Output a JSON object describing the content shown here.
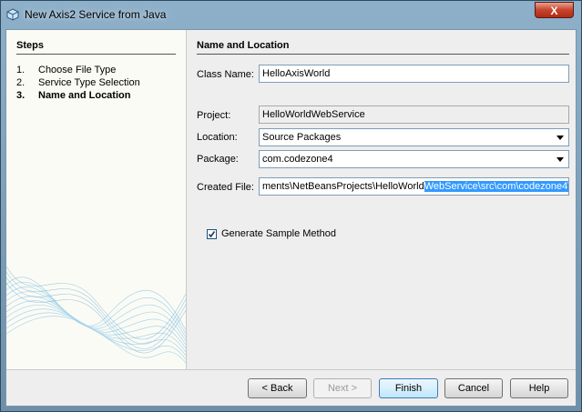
{
  "window": {
    "title": "New Axis2 Service from Java",
    "close_label": "X"
  },
  "steps": {
    "title": "Steps",
    "items": [
      {
        "num": "1.",
        "label": "Choose File Type"
      },
      {
        "num": "2.",
        "label": "Service Type Selection"
      },
      {
        "num": "3.",
        "label": "Name and Location"
      }
    ]
  },
  "panel": {
    "title": "Name and Location",
    "class_name": {
      "label": "Class Name:",
      "value": "HelloAxisWorld"
    },
    "project": {
      "label": "Project:",
      "value": "HelloWorldWebService"
    },
    "location": {
      "label": "Location:",
      "value": "Source Packages"
    },
    "package": {
      "label": "Package:",
      "value": "com.codezone4"
    },
    "created_file": {
      "label": "Created File:",
      "value_plain": "ments\\NetBeansProjects\\HelloWorld",
      "value_selected": "WebService\\src\\com\\codezone4\\H"
    },
    "generate_sample": {
      "label": "Generate Sample Method",
      "checked": true
    }
  },
  "buttons": {
    "back": "< Back",
    "next": "Next >",
    "finish": "Finish",
    "cancel": "Cancel",
    "help": "Help"
  },
  "colors": {
    "selection": "#3399ff",
    "close_button": "#c7432b"
  },
  "icons": {
    "window": "netbeans-cube-icon",
    "checkbox": "check-icon",
    "combo": "chevron-down-icon"
  }
}
